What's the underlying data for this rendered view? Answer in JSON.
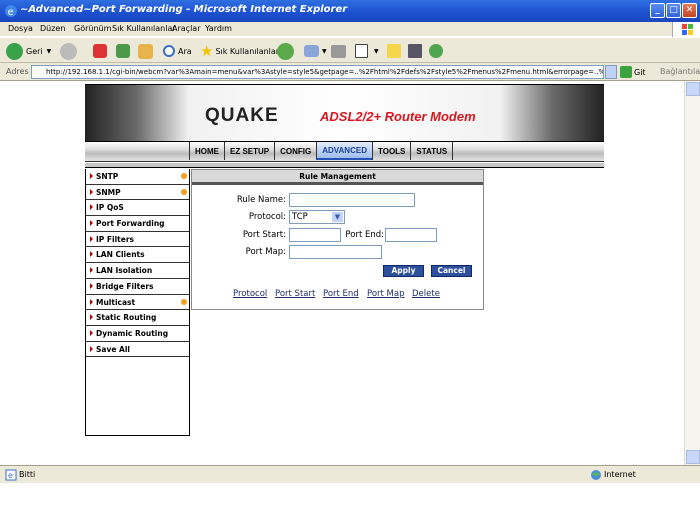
{
  "window": {
    "title": "~Advanced~Port Forwarding - Microsoft Internet Explorer",
    "min": "_",
    "max": "□",
    "close": "✕"
  },
  "menu": [
    "Dosya",
    "Düzen",
    "Görünüm",
    "Sık Kullanılanlar",
    "Araçlar",
    "Yardım"
  ],
  "toolbar": {
    "back_label": "Geri",
    "search_label": "Ara",
    "favorites_label": "Sık Kullanılanlar"
  },
  "address": {
    "label": "Adres",
    "url": "http://192.168.1.1/cgi-bin/webcm?var%3Amain=menu&var%3Astyle=style5&getpage=..%2Fhtml%2Fdefs%2Fstyle5%2Fmenus%2Fmenu.html&errorpage=..%2Fhtml",
    "go_label": "Git",
    "links_label": "Bağlantılar"
  },
  "status": {
    "text": "Bitti",
    "zone": "Internet"
  },
  "router": {
    "brand": "QUAKE",
    "product": "ADSL2/2+ Router Modem",
    "nav": [
      "HOME",
      "EZ SETUP",
      "CONFIG",
      "ADVANCED",
      "TOOLS",
      "STATUS"
    ],
    "active_nav": "ADVANCED",
    "sidebar": [
      {
        "label": "SNTP",
        "dot": true
      },
      {
        "label": "SNMP",
        "dot": true
      },
      {
        "label": "IP QoS",
        "dot": false
      },
      {
        "label": "Port Forwarding",
        "dot": false
      },
      {
        "label": "IP Filters",
        "dot": false
      },
      {
        "label": "LAN Clients",
        "dot": false
      },
      {
        "label": "LAN Isolation",
        "dot": false
      },
      {
        "label": "Bridge Filters",
        "dot": false
      },
      {
        "label": "Multicast",
        "dot": true
      },
      {
        "label": "Static Routing",
        "dot": false
      },
      {
        "label": "Dynamic Routing",
        "dot": false
      },
      {
        "label": "Save All",
        "dot": false
      }
    ],
    "panel": {
      "title": "Rule Management",
      "rule_name_label": "Rule Name:",
      "rule_name_value": "",
      "protocol_label": "Protocol:",
      "protocol_value": "TCP",
      "port_start_label": "Port Start:",
      "port_end_label": "Port End:",
      "port_map_label": "Port Map:",
      "apply": "Apply",
      "cancel": "Cancel",
      "columns": [
        "Protocol",
        "Port Start",
        "Port End",
        "Port Map",
        "Delete"
      ]
    }
  },
  "colors": {
    "titlebar": "#1c4fcf",
    "brand_red": "#d9151f",
    "button_blue": "#2e4f9c"
  }
}
